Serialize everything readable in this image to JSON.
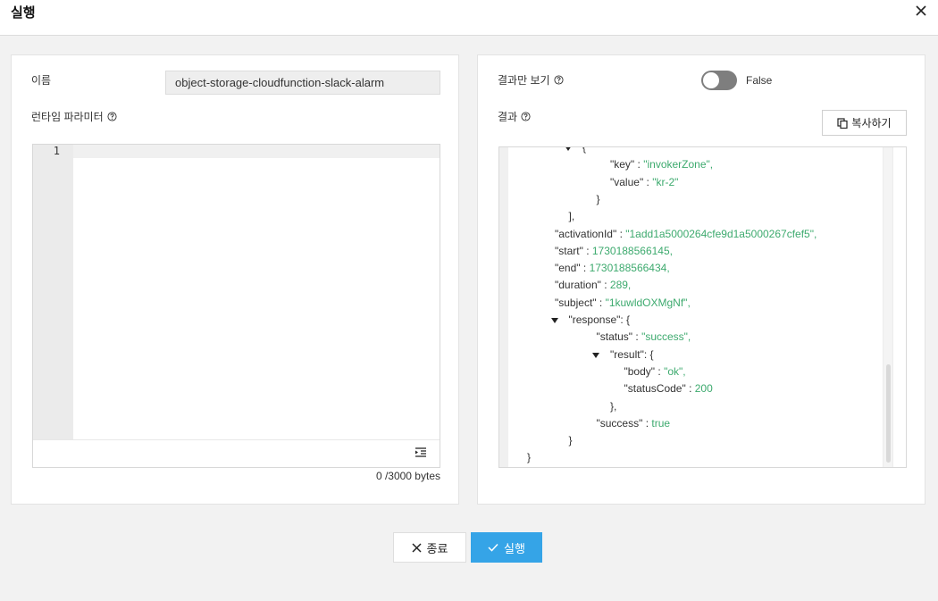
{
  "modal": {
    "title": "실행"
  },
  "left": {
    "name_label": "이름",
    "name_value": "object-storage-cloudfunction-slack-alarm",
    "params_label": "런타임 파라미터",
    "editor_line_number": "1",
    "byte_count": "0 /3000 bytes"
  },
  "right": {
    "result_only_label": "결과만 보기",
    "toggle_state": "False",
    "toggle_on": false,
    "result_label": "결과",
    "copy_label": "복사하기",
    "json_lines": [
      {
        "indent": 6,
        "caret": true,
        "parts": [
          {
            "t": "{",
            "k": "p"
          }
        ]
      },
      {
        "indent": 8,
        "parts": [
          {
            "t": "\"key\"",
            "k": "k"
          },
          {
            "t": " : ",
            "k": "p"
          },
          {
            "t": "\"invokerZone\",",
            "k": "v"
          }
        ]
      },
      {
        "indent": 8,
        "parts": [
          {
            "t": "\"value\"",
            "k": "k"
          },
          {
            "t": " : ",
            "k": "p"
          },
          {
            "t": "\"kr-2\"",
            "k": "v"
          }
        ]
      },
      {
        "indent": 7,
        "parts": [
          {
            "t": "}",
            "k": "p"
          }
        ]
      },
      {
        "indent": 5,
        "parts": [
          {
            "t": "],",
            "k": "p"
          }
        ]
      },
      {
        "indent": 4,
        "parts": [
          {
            "t": "\"activationId\"",
            "k": "k"
          },
          {
            "t": " : ",
            "k": "p"
          },
          {
            "t": "\"1add1a5000264cfe9d1a5000267cfef5\",",
            "k": "v"
          }
        ]
      },
      {
        "indent": 4,
        "parts": [
          {
            "t": "\"start\"",
            "k": "k"
          },
          {
            "t": " : ",
            "k": "p"
          },
          {
            "t": "1730188566145,",
            "k": "v"
          }
        ]
      },
      {
        "indent": 4,
        "parts": [
          {
            "t": "\"end\"",
            "k": "k"
          },
          {
            "t": " : ",
            "k": "p"
          },
          {
            "t": "1730188566434,",
            "k": "v"
          }
        ]
      },
      {
        "indent": 4,
        "parts": [
          {
            "t": "\"duration\"",
            "k": "k"
          },
          {
            "t": " : ",
            "k": "p"
          },
          {
            "t": "289,",
            "k": "v"
          }
        ]
      },
      {
        "indent": 4,
        "parts": [
          {
            "t": "\"subject\"",
            "k": "k"
          },
          {
            "t": " : ",
            "k": "p"
          },
          {
            "t": "\"1kuwldOXMgNf\",",
            "k": "v"
          }
        ]
      },
      {
        "indent": 5,
        "caret": true,
        "parts": [
          {
            "t": "\"response\"",
            "k": "k"
          },
          {
            "t": ": {",
            "k": "p"
          }
        ]
      },
      {
        "indent": 7,
        "parts": [
          {
            "t": "\"status\"",
            "k": "k"
          },
          {
            "t": " : ",
            "k": "p"
          },
          {
            "t": "\"success\",",
            "k": "v"
          }
        ]
      },
      {
        "indent": 8,
        "caret": true,
        "parts": [
          {
            "t": "\"result\"",
            "k": "k"
          },
          {
            "t": ": {",
            "k": "p"
          }
        ]
      },
      {
        "indent": 9,
        "parts": [
          {
            "t": "\"body\"",
            "k": "k"
          },
          {
            "t": " : ",
            "k": "p"
          },
          {
            "t": "\"ok\",",
            "k": "v"
          }
        ]
      },
      {
        "indent": 9,
        "parts": [
          {
            "t": "\"statusCode\"",
            "k": "k"
          },
          {
            "t": " : ",
            "k": "p"
          },
          {
            "t": "200",
            "k": "v"
          }
        ]
      },
      {
        "indent": 8,
        "parts": [
          {
            "t": "},",
            "k": "p"
          }
        ]
      },
      {
        "indent": 7,
        "parts": [
          {
            "t": "\"success\"",
            "k": "k"
          },
          {
            "t": " : ",
            "k": "p"
          },
          {
            "t": "true",
            "k": "v"
          }
        ]
      },
      {
        "indent": 5,
        "parts": [
          {
            "t": "}",
            "k": "p"
          }
        ]
      },
      {
        "indent": 2,
        "parts": [
          {
            "t": "}",
            "k": "p"
          }
        ]
      }
    ]
  },
  "footer": {
    "close_label": "종료",
    "run_label": "실행"
  },
  "colors": {
    "primary": "#35a4e7",
    "json_value": "#3daa6e",
    "toggle_off": "#7e7e7e"
  }
}
